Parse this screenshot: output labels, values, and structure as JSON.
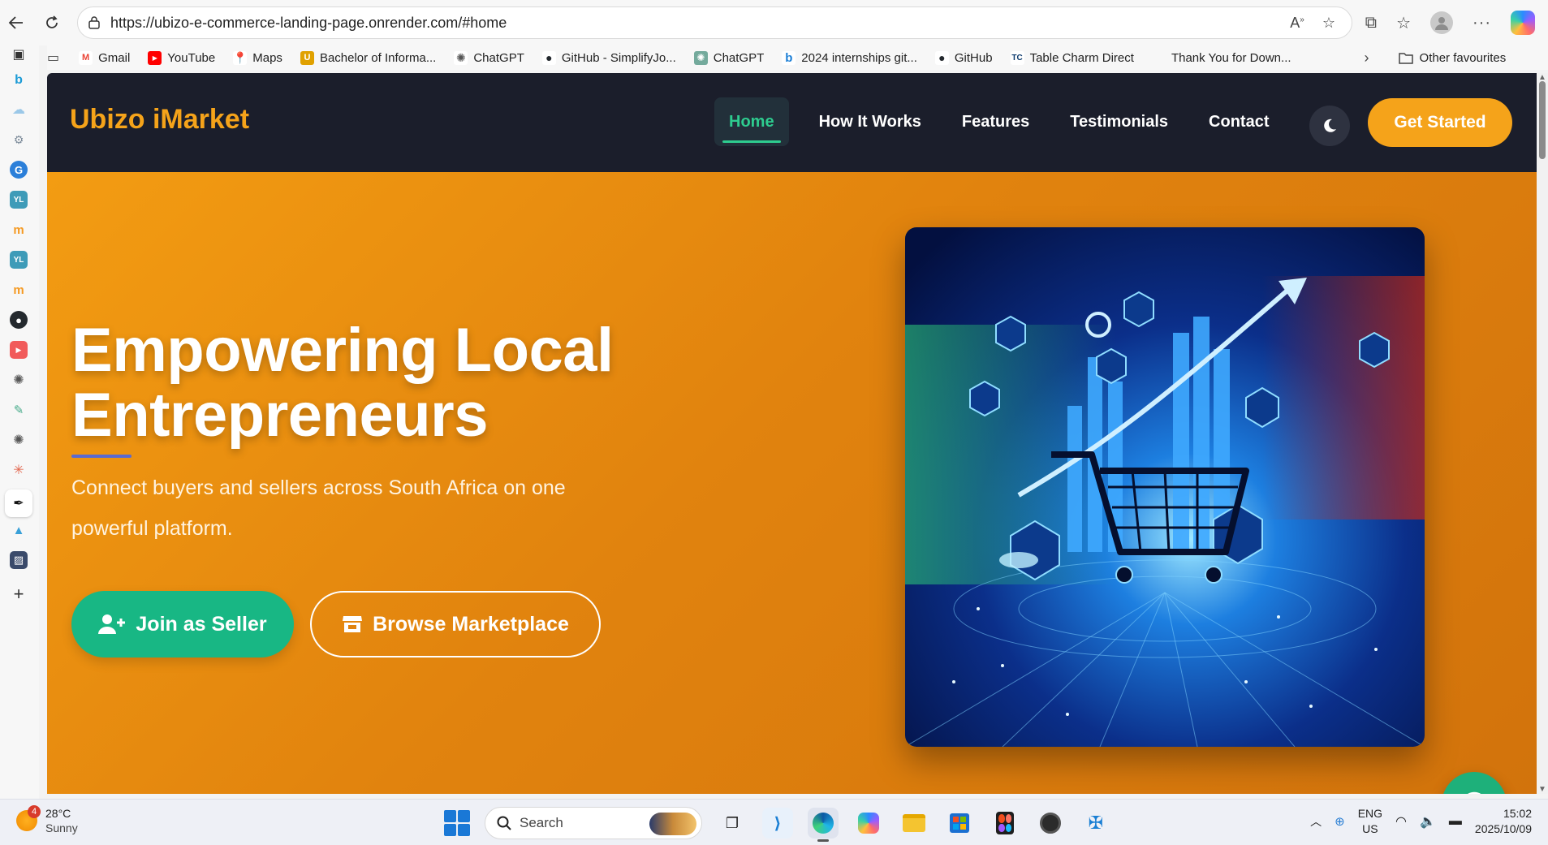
{
  "browser": {
    "url": "https://ubizo-e-commerce-landing-page.onrender.com/#home",
    "favorites": [
      {
        "label": "Gmail",
        "color": "#ea4335",
        "glyph": "M"
      },
      {
        "label": "YouTube",
        "color": "#ff0000",
        "glyph": "▶"
      },
      {
        "label": "Maps",
        "color": "#34a853",
        "glyph": "◆"
      },
      {
        "label": "Bachelor of Informa...",
        "color": "#e0a100",
        "glyph": "U"
      },
      {
        "label": "ChatGPT",
        "color": "#555555",
        "glyph": "✺"
      },
      {
        "label": "GitHub - SimplifyJo...",
        "color": "#24292e",
        "glyph": "●"
      },
      {
        "label": "ChatGPT",
        "color": "#74aa9c",
        "glyph": "✺"
      },
      {
        "label": "2024 internships git...",
        "color": "#1c7fd6",
        "glyph": "b"
      },
      {
        "label": "GitHub",
        "color": "#24292e",
        "glyph": "●"
      },
      {
        "label": "Table Charm Direct",
        "color": "#0d3b6e",
        "glyph": "TC"
      },
      {
        "label": "Thank You for Down...",
        "color": "#f25022",
        "glyph": "▦"
      }
    ],
    "other_favourites": "Other favourites"
  },
  "site": {
    "logo": "Ubizo iMarket",
    "nav": [
      "Home",
      "How It Works",
      "Features",
      "Testimonials",
      "Contact"
    ],
    "cta": "Get Started"
  },
  "hero": {
    "title": "Empowering Local Entrepreneurs",
    "subtitle": "Connect buyers and sellers across South Africa on one powerful platform.",
    "primary_button": "Join as Seller",
    "secondary_button": "Browse Marketplace"
  },
  "taskbar": {
    "temperature": "28°C",
    "condition": "Sunny",
    "weather_badge": "4",
    "search_placeholder": "Search",
    "lang_1": "ENG",
    "lang_2": "US",
    "time": "15:02",
    "date": "2025/10/09"
  },
  "colors": {
    "brand_orange": "#f5a31a",
    "nav_bg": "#1b1e2b",
    "accent_green": "#18b784"
  }
}
